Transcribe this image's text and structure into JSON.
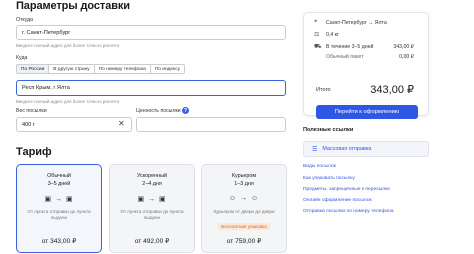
{
  "page": {
    "title": "Параметры доставки"
  },
  "form": {
    "from": {
      "label": "Откуда",
      "value": "г. Санкт-Петербург",
      "hint": "Введите полный адрес для более точного расчёта"
    },
    "to_label": "Куда",
    "tabs": [
      "По России",
      "В другую страну",
      "По номеру телефона",
      "По индексу"
    ],
    "selected_tab": 0,
    "to": {
      "value": "Респ Крым, г Ялта",
      "hint": "Введите полный адрес для более точного расчёта"
    },
    "weight": {
      "label": "Вес посылки",
      "value": "400 г"
    },
    "declared": {
      "label": "Ценность посылки",
      "value": "",
      "help": "?"
    }
  },
  "tariff_section": {
    "title": "Тариф"
  },
  "tariffs": [
    {
      "name": "Обычный",
      "days": "3–5 дней",
      "icons": "▣ → ▣",
      "desc": "От пункта отправки до пункта выдачи",
      "badge": "",
      "price": "от 343,00 ₽",
      "selected": true
    },
    {
      "name": "Ускоренный",
      "days": "2–4 дня",
      "icons": "▣ → ▣",
      "desc": "От пункта отправки до пункта выдачи",
      "badge": "",
      "price": "от 492,00 ₽",
      "selected": false
    },
    {
      "name": "Курьером",
      "days": "1–3 дня",
      "icons": "☺ → ☺",
      "desc": "Курьером от двери до двери",
      "badge": "Бесплатная упаковка",
      "price": "от 759,00 ₽",
      "selected": false
    }
  ],
  "summary": {
    "route": "Санкт-Петербург → Ялта",
    "weight": "0,4 кг",
    "term": "В течение 3–5 дней",
    "term_price": "343,00 ₽",
    "package": "Обычный пакет",
    "package_price": "0,00 ₽",
    "total_label": "Итого",
    "total_value": "343,00 ₽",
    "checkout_label": "Перейти к оформлению"
  },
  "links": {
    "title": "Полезные ссылки",
    "bulk": "Массовая отправка",
    "items": [
      "Виды посылок",
      "Как упаковать посылку",
      "Предметы, запрещённые к пересылке",
      "Онлайн оформление посылок",
      "Отправка посылки по номеру телефона"
    ]
  },
  "icons": {
    "pin": "pin-icon",
    "weight": "weight-icon",
    "truck": "truck-icon",
    "box": "box-icon",
    "bulk": "mass-send-icon"
  },
  "colors": {
    "accent": "#2f57e6",
    "badge_text": "#e06a1a",
    "badge_bg": "#fde7d6"
  }
}
